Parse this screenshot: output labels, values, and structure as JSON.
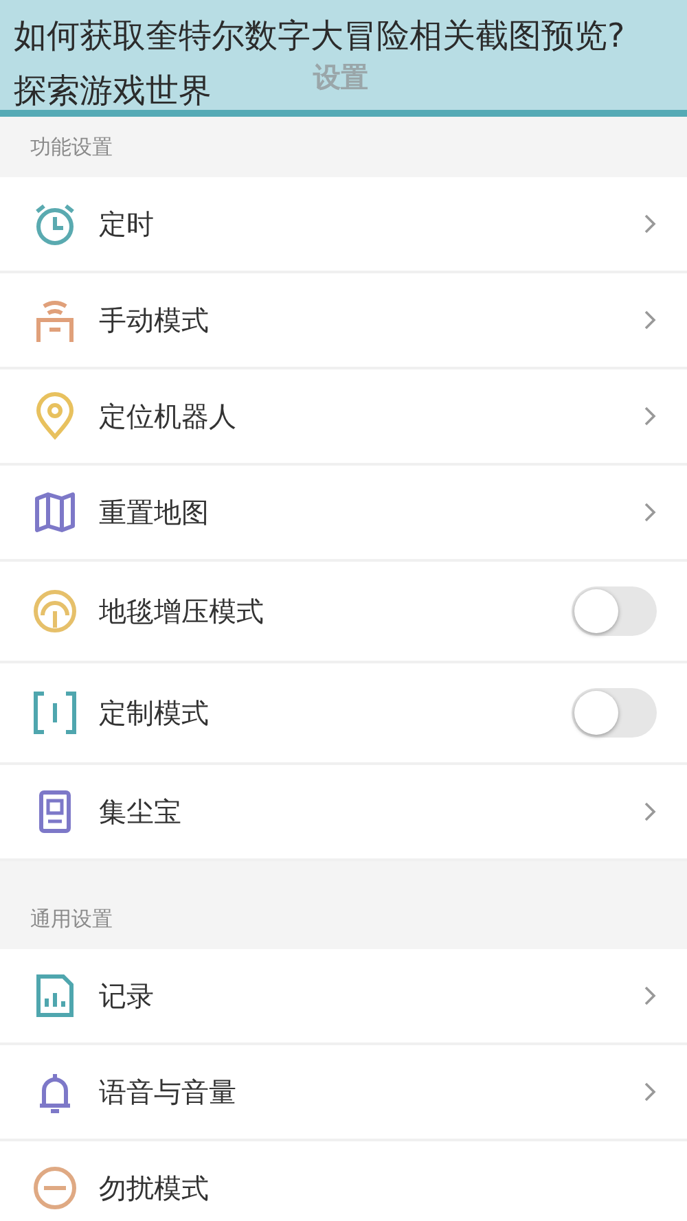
{
  "caption": [
    "如何获取奎特尔数字大冒险相关截图预览?",
    "探索游戏世界"
  ],
  "header": {
    "title": "设置"
  },
  "sections": [
    {
      "title": "功能设置",
      "items": [
        {
          "label": "定时",
          "kind": "link"
        },
        {
          "label": "手动模式",
          "kind": "link"
        },
        {
          "label": "定位机器人",
          "kind": "link"
        },
        {
          "label": "重置地图",
          "kind": "link"
        },
        {
          "label": "地毯增压模式",
          "kind": "toggle",
          "on": false
        },
        {
          "label": "定制模式",
          "kind": "toggle",
          "on": false
        },
        {
          "label": "集尘宝",
          "kind": "link"
        }
      ]
    },
    {
      "title": "通用设置",
      "items": [
        {
          "label": "记录",
          "kind": "link"
        },
        {
          "label": "语音与音量",
          "kind": "link"
        },
        {
          "label": "勿扰模式",
          "kind": "plain"
        }
      ]
    }
  ]
}
